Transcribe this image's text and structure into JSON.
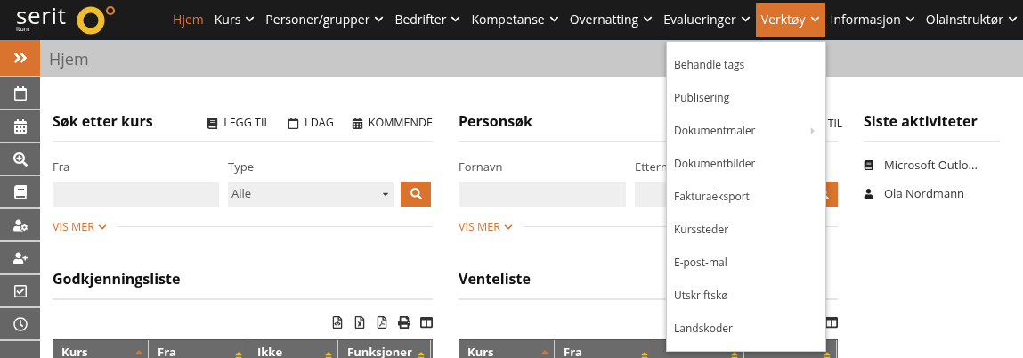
{
  "logo": {
    "name": "serit",
    "subtitle": "Itum"
  },
  "nav": [
    {
      "label": "Hjem",
      "dropdown": false,
      "selected": true,
      "open": false
    },
    {
      "label": "Kurs",
      "dropdown": true,
      "selected": false,
      "open": false
    },
    {
      "label": "Personer/grupper",
      "dropdown": true,
      "selected": false,
      "open": false
    },
    {
      "label": "Bedrifter",
      "dropdown": true,
      "selected": false,
      "open": false
    },
    {
      "label": "Kompetanse",
      "dropdown": true,
      "selected": false,
      "open": false
    },
    {
      "label": "Overnatting",
      "dropdown": true,
      "selected": false,
      "open": false
    },
    {
      "label": "Evalueringer",
      "dropdown": true,
      "selected": false,
      "open": false
    },
    {
      "label": "Verktøy",
      "dropdown": true,
      "selected": false,
      "open": true
    },
    {
      "label": "Informasjon",
      "dropdown": true,
      "selected": false,
      "open": false
    },
    {
      "label": "OlaInstruktør",
      "dropdown": true,
      "selected": false,
      "open": false
    }
  ],
  "dropdown_menu": [
    {
      "label": "Behandle tags",
      "submenu": false
    },
    {
      "label": "Publisering",
      "submenu": false
    },
    {
      "label": "Dokumentmaler",
      "submenu": true
    },
    {
      "label": "Dokumentbilder",
      "submenu": false
    },
    {
      "label": "Fakturaeksport",
      "submenu": false
    },
    {
      "label": "Kurssteder",
      "submenu": false
    },
    {
      "label": "E-post-mal",
      "submenu": false
    },
    {
      "label": "Utskriftskø",
      "submenu": false
    },
    {
      "label": "Landskoder",
      "submenu": false
    }
  ],
  "page_title": "Hjem",
  "course_search": {
    "title": "Søk etter kurs",
    "actions": [
      "LEGG TIL",
      "I DAG",
      "KOMMENDE"
    ],
    "from_label": "Fra",
    "type_label": "Type",
    "type_value": "Alle",
    "more": "VIS MER"
  },
  "approval_list": {
    "title": "Godkjenningsliste",
    "columns": [
      "Kurs",
      "Fra",
      "Ikke",
      "Funksjoner"
    ]
  },
  "person_search": {
    "title": "Personsøk",
    "action": "TIL",
    "first_name_label": "Fornavn",
    "last_name_label": "Ettern",
    "more": "VIS MER"
  },
  "waiting_list": {
    "title": "Venteliste",
    "columns": [
      "Kurs",
      "Fra"
    ]
  },
  "recent": {
    "title": "Siste aktiviteter",
    "items": [
      {
        "kind": "course",
        "label": "Microsoft Outlo..."
      },
      {
        "kind": "person",
        "label": "Ola Nordmann"
      }
    ]
  }
}
